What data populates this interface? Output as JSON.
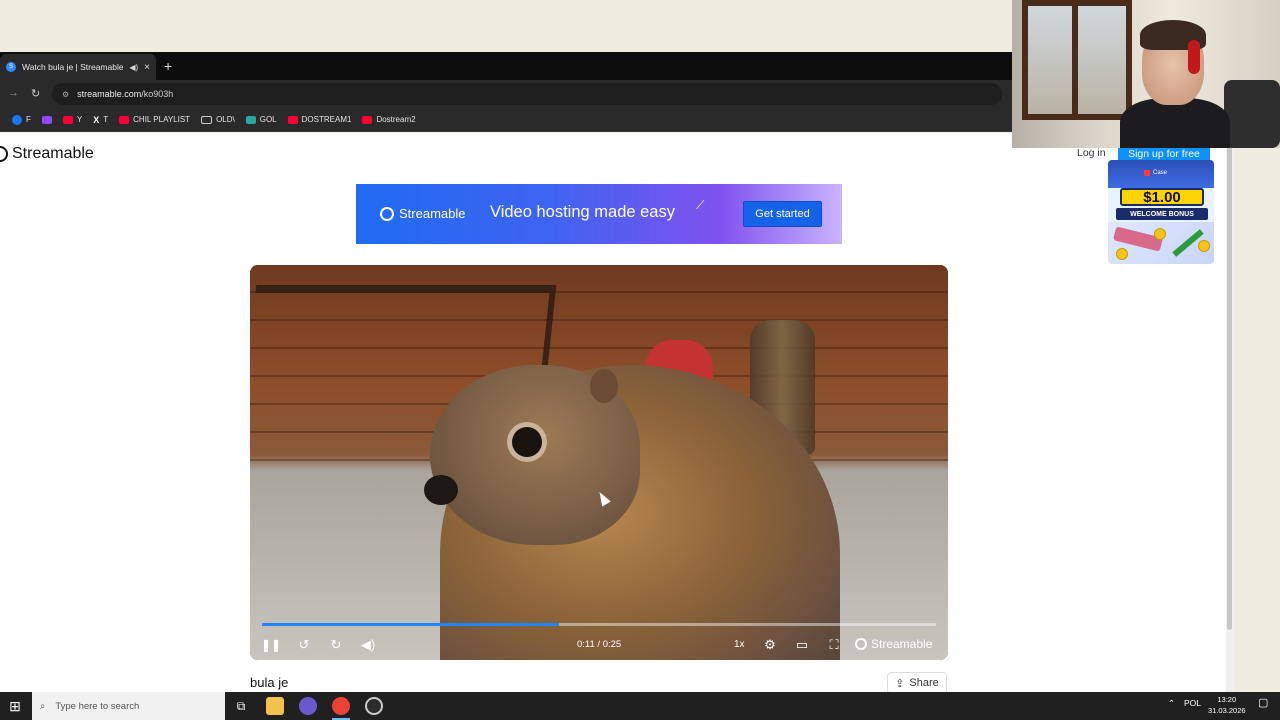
{
  "browser": {
    "tab": {
      "title": "Watch bula je | Streamable",
      "audio_icon": "speaker-icon",
      "close_label": "×"
    },
    "new_tab_label": "+",
    "address": {
      "host": "streamable.com",
      "path": "/ko903h"
    },
    "bookmarks": [
      {
        "label": "F",
        "icon": "facebook-icon"
      },
      {
        "label": "",
        "icon": "twitch-icon"
      },
      {
        "label": "Y",
        "icon": "youtube-icon"
      },
      {
        "label": "T",
        "icon": "x-icon"
      },
      {
        "label": "CHIL PLAYLIST",
        "icon": "youtube-icon"
      },
      {
        "label": "OLD\\",
        "icon": "folder-icon"
      },
      {
        "label": "GOL",
        "icon": "g-icon"
      },
      {
        "label": "DOSTREAM1",
        "icon": "youtube-icon"
      },
      {
        "label": "Dostream2",
        "icon": "youtube-icon"
      }
    ]
  },
  "site": {
    "logo": "Streamable",
    "login_label": "Log in",
    "signup_label": "Sign up for free"
  },
  "side_ad": {
    "brand": "Case",
    "amount": "$1.00",
    "bonus": "WELCOME BONUS"
  },
  "banner": {
    "logo": "Streamable",
    "tagline": "Video hosting made easy",
    "cta": "Get started"
  },
  "player": {
    "current_time": "0:11",
    "duration": "0:25",
    "time_text": "0:11 / 0:25",
    "progress_percent": 44,
    "speed": "1x",
    "watermark": "Streamable",
    "accent": "#1f86ff"
  },
  "video": {
    "title": "bula je",
    "share_label": "Share"
  },
  "taskbar": {
    "search_placeholder": "Type here to search",
    "language": "POL",
    "time": "13:20",
    "date": "31.03.2026"
  }
}
